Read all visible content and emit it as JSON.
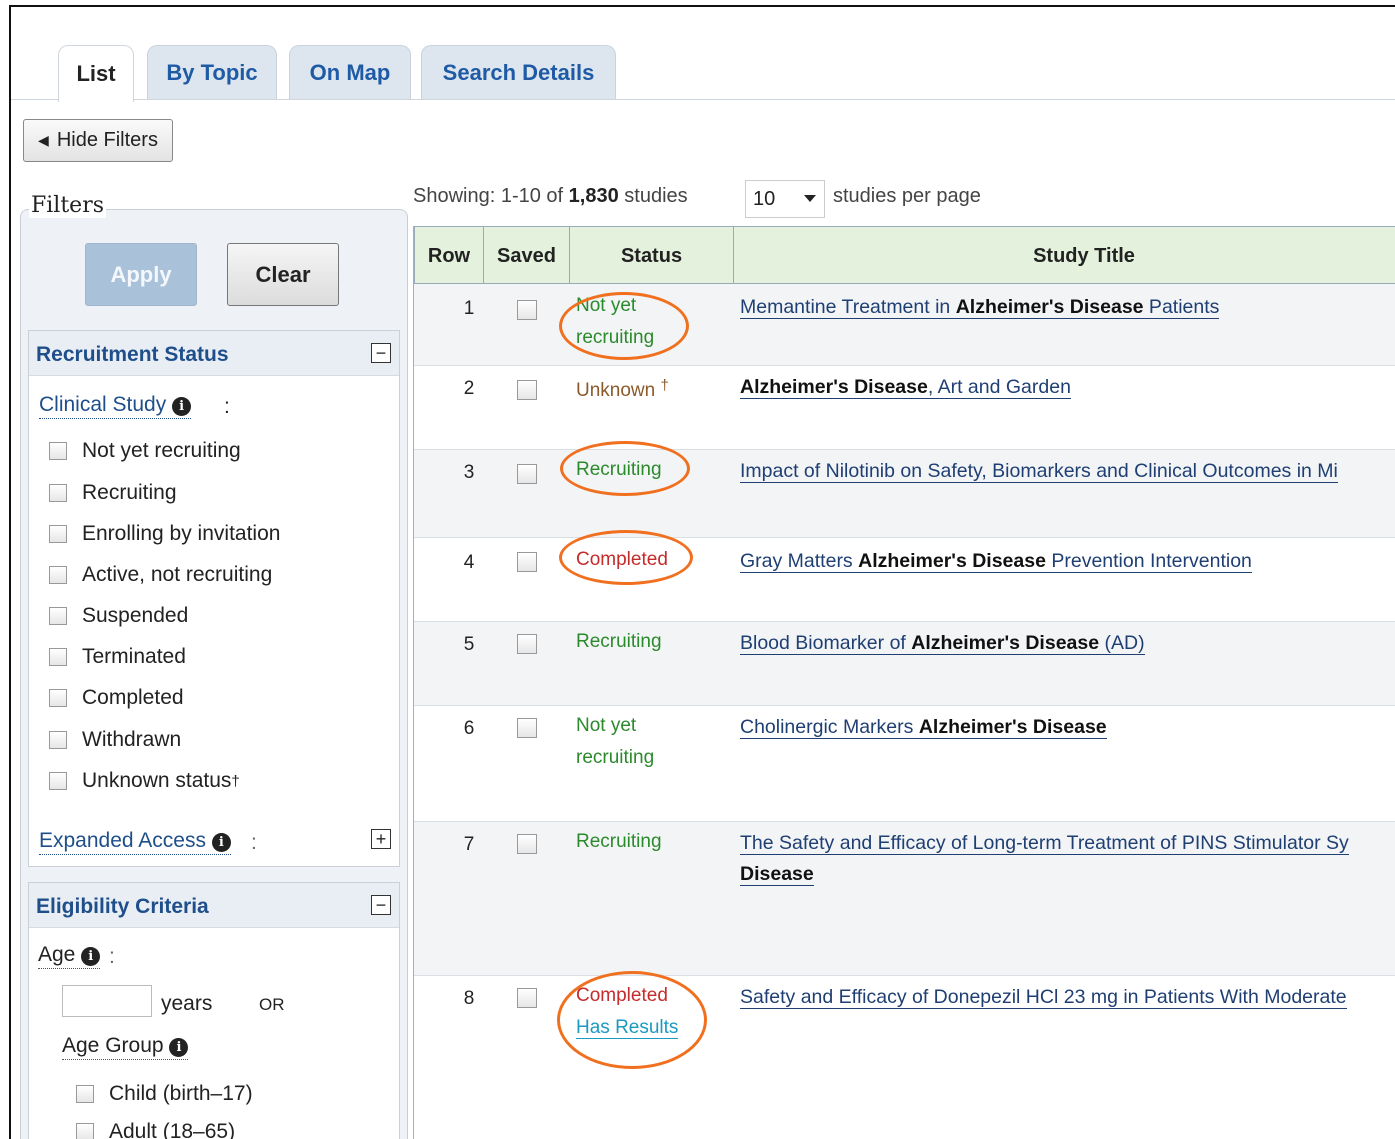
{
  "tabs": [
    "List",
    "By Topic",
    "On Map",
    "Search Details"
  ],
  "hide_filters": "Hide Filters",
  "filters": {
    "legend": "Filters",
    "apply": "Apply",
    "clear": "Clear",
    "recruitment": {
      "title": "Recruitment Status",
      "clinical_label": "Clinical Study",
      "options": [
        "Not yet recruiting",
        "Recruiting",
        "Enrolling by invitation",
        "Active, not recruiting",
        "Suspended",
        "Terminated",
        "Completed",
        "Withdrawn",
        "Unknown status"
      ],
      "dagger": "†",
      "expanded_label": "Expanded Access"
    },
    "eligibility": {
      "title": "Eligibility Criteria",
      "age_label": "Age",
      "years": "years",
      "or": "OR",
      "age_group_label": "Age Group",
      "groups": [
        "Child (birth–17)",
        "Adult (18–65)"
      ]
    }
  },
  "results": {
    "showing_prefix": "Showing: 1-10 of ",
    "total": "1,830",
    "showing_suffix": " studies",
    "per_page_value": "10",
    "per_page_label": "studies per page",
    "columns": [
      "Row",
      "Saved",
      "Status",
      "Study Title"
    ],
    "rows": [
      {
        "num": "1",
        "status": [
          "Not yet",
          "recruiting"
        ],
        "title_pre": "Memantine Treatment in ",
        "title_bold": "Alzheimer's Disease",
        "title_post": " Patients"
      },
      {
        "num": "2",
        "status": [
          "Unknown"
        ],
        "dagger": "†",
        "title_pre": "",
        "title_bold": "Alzheimer's Disease",
        "title_post": ", Art and Garden"
      },
      {
        "num": "3",
        "status": [
          "Recruiting"
        ],
        "title_pre": "Impact of Nilotinib on Safety, Biomarkers and Clinical Outcomes in Mi",
        "title_bold": "",
        "title_post": ""
      },
      {
        "num": "4",
        "status": [
          "Completed"
        ],
        "title_pre": "Gray Matters ",
        "title_bold": "Alzheimer's Disease",
        "title_post": " Prevention Intervention"
      },
      {
        "num": "5",
        "status": [
          "Recruiting"
        ],
        "title_pre": "Blood Biomarker of ",
        "title_bold": "Alzheimer's Disease",
        "title_post": " (AD)"
      },
      {
        "num": "6",
        "status": [
          "Not yet",
          "recruiting"
        ],
        "title_pre": "Cholinergic Markers ",
        "title_bold": "Alzheimer's Disease",
        "title_post": ""
      },
      {
        "num": "7",
        "status": [
          "Recruiting"
        ],
        "title_pre": "The Safety and Efficacy of Long-term Treatment of PINS Stimulator Sy",
        "title_bold": "Disease",
        "title_post": ""
      },
      {
        "num": "8",
        "status": [
          "Completed"
        ],
        "has_results": "Has Results",
        "title_pre": "Safety and Efficacy of Donepezil HCl 23 mg in Patients With Moderate",
        "title_bold": "",
        "title_post": ""
      }
    ]
  },
  "colors": {
    "accent": "#1f4f8a",
    "highlight": "#f07020",
    "green": "#2b8a2b",
    "red": "#c52b2b"
  }
}
